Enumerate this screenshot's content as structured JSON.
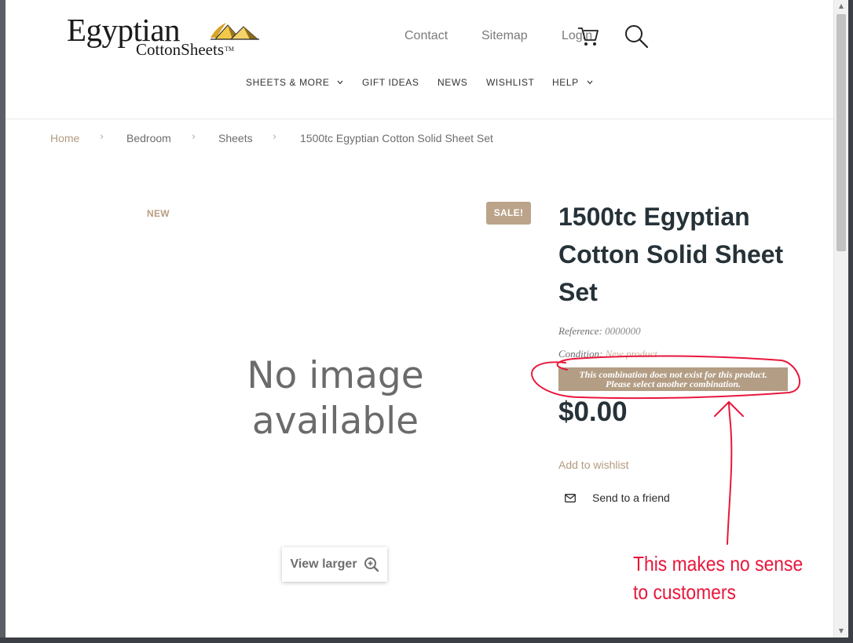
{
  "header": {
    "logo": {
      "main": "Egyptian",
      "sub": "CottonSheets",
      "tm": "TM"
    },
    "top_links": [
      {
        "label": "Contact"
      },
      {
        "label": "Sitemap"
      },
      {
        "label": "Login"
      }
    ],
    "icons": {
      "cart": "cart-icon",
      "search": "search-icon"
    }
  },
  "nav": {
    "items": [
      {
        "label": "SHEETS & MORE",
        "has_dropdown": true
      },
      {
        "label": "GIFT IDEAS",
        "has_dropdown": false
      },
      {
        "label": "NEWS",
        "has_dropdown": false
      },
      {
        "label": "WISHLIST",
        "has_dropdown": false
      },
      {
        "label": "HELP",
        "has_dropdown": true
      }
    ]
  },
  "breadcrumb": [
    "Home",
    "Bedroom",
    "Sheets",
    "1500tc Egyptian Cotton Solid Sheet Set"
  ],
  "product": {
    "badge_new": "NEW",
    "badge_sale": "SALE!",
    "image_placeholder_line1": "No image",
    "image_placeholder_line2": "available",
    "view_larger": "View larger",
    "title": "1500tc Egyptian Cotton Solid Sheet Set",
    "reference_label": "Reference:",
    "reference_value": "0000000",
    "condition_label": "Condition:",
    "condition_value": "New product",
    "combination_alert": "This combination does not exist for this product. Please select another combination.",
    "price": "$0.00",
    "add_to_wishlist": "Add to wishlist",
    "send_to_friend": "Send to a friend"
  },
  "annotation": {
    "line1": "This makes no sense",
    "line2": "to customers",
    "color": "#e8173c"
  },
  "colors": {
    "accent_tan": "#b39b7f",
    "sale_badge": "#bba48a",
    "title_dark": "#263238"
  }
}
